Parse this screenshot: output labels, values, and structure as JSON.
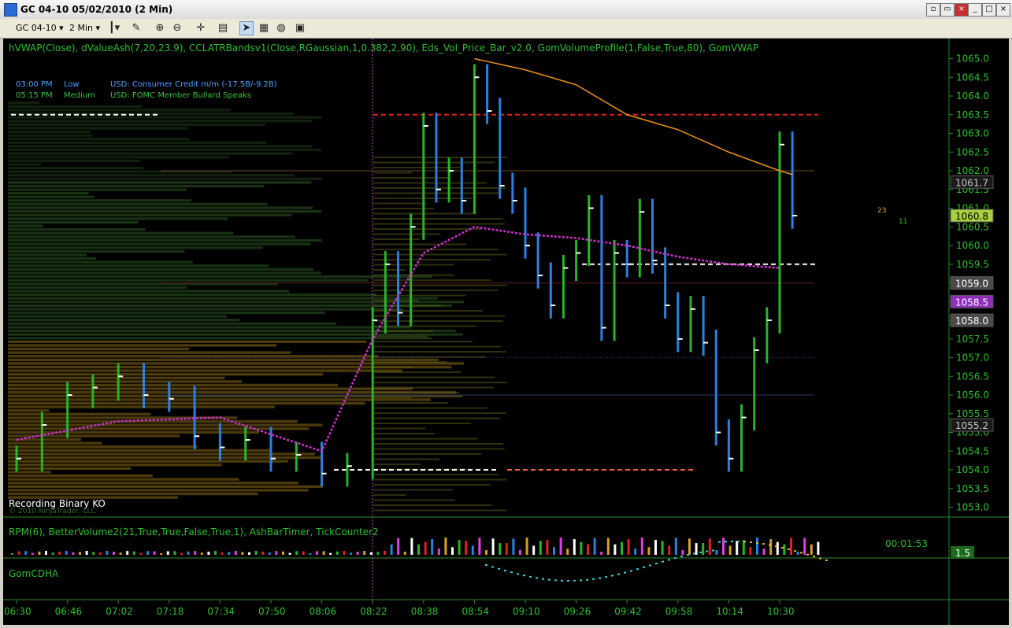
{
  "window": {
    "title": "GC 04-10  05/02/2010 (2 Min)",
    "buttons": [
      "minimize",
      "maximize",
      "close",
      "restore-sub",
      "maximize-sub",
      "close-sub"
    ]
  },
  "toolbar": {
    "instrument": "GC 04-10",
    "interval": "2 Min",
    "icons": [
      "bar-type-icon",
      "draw-icon",
      "zoom-in-icon",
      "zoom-out-icon",
      "crosshair-icon",
      "properties-icon",
      "strategy-icon",
      "chart-trader-icon",
      "indicator-icon",
      "data-box-icon"
    ]
  },
  "chart_data": {
    "type": "line",
    "indicator_header": "hVWAP(Close), dValueAsh(7,20,23.9), CCLATRBandsv1(Close,RGaussian,1,0.382,2,90), Eds_Vol_Price_Bar_v2.0, GomVolumeProfile(1,False,True,80), GomVWAP",
    "news": [
      {
        "time": "03:00 PM",
        "impact": "Low",
        "event": "USD: Consumer Credit m/m (-17.5B/-9.2B)"
      },
      {
        "time": "05:15 PM",
        "impact": "Medium",
        "event": "USD: FOMC Member Bullard Speaks"
      }
    ],
    "status_text": "Recording Binary KO",
    "copyright": "© 2010 NinjaTrader, LLC",
    "x_ticks": [
      "06:30",
      "06:46",
      "07:02",
      "07:18",
      "07:34",
      "07:50",
      "08:06",
      "08:22",
      "08:38",
      "08:54",
      "09:10",
      "09:26",
      "09:42",
      "09:58",
      "10:14",
      "10:30"
    ],
    "y_ticks": [
      "1065.0",
      "1064.5",
      "1064.0",
      "1063.5",
      "1063.0",
      "1062.5",
      "1062.0",
      "1061.5",
      "1061.0",
      "1060.5",
      "1060.0",
      "1059.5",
      "1059.0",
      "1058.5",
      "1058.0",
      "1057.5",
      "1057.0",
      "1056.5",
      "1056.0",
      "1055.5",
      "1055.0",
      "1054.5",
      "1054.0",
      "1053.5",
      "1053.0"
    ],
    "ylim": [
      1052.8,
      1065.2
    ],
    "price_labels": [
      {
        "value": 1061.7,
        "text": "1061.7",
        "color": "#1a1a1a",
        "fg": "#c8c8c8"
      },
      {
        "value": 1060.8,
        "text": "1060.8",
        "color": "#a8d040",
        "fg": "#000000"
      },
      {
        "value": 1059.0,
        "text": "1059.0",
        "color": "#4a4a4a",
        "fg": "#ffffff"
      },
      {
        "value": 1058.5,
        "text": "1058.5",
        "color": "#8e2fb8",
        "fg": "#ffffff"
      },
      {
        "value": 1058.0,
        "text": "1058.0",
        "color": "#4a4a4a",
        "fg": "#ffffff"
      },
      {
        "value": 1055.2,
        "text": "1055.2",
        "color": "#1a1a1a",
        "fg": "#c8c8c8"
      }
    ],
    "side_counts": [
      {
        "text": "23",
        "color": "#e8a020"
      },
      {
        "text": "11",
        "color": "#30c030"
      }
    ],
    "levels": [
      {
        "value": 1063.5,
        "color": "#e02020",
        "style": "dashed"
      },
      {
        "value": 1054.0,
        "color": "#ffffff",
        "style": "dashed"
      },
      {
        "value": 1059.5,
        "color": "#ffffff",
        "style": "dashed"
      }
    ],
    "series": [
      {
        "name": "Close",
        "color": "#30b030",
        "x": [
          "06:30",
          "06:38",
          "06:46",
          "06:54",
          "07:02",
          "07:10",
          "07:18",
          "07:26",
          "07:34",
          "07:42",
          "07:50",
          "07:58",
          "08:06",
          "08:14",
          "08:22",
          "08:26",
          "08:30",
          "08:34",
          "08:38",
          "08:42",
          "08:46",
          "08:50",
          "08:54",
          "08:58",
          "09:02",
          "09:06",
          "09:10",
          "09:14",
          "09:18",
          "09:22",
          "09:26",
          "09:30",
          "09:34",
          "09:38",
          "09:42",
          "09:46",
          "09:50",
          "09:54",
          "09:58",
          "10:02",
          "10:06",
          "10:10",
          "10:14",
          "10:18",
          "10:22",
          "10:26",
          "10:30",
          "10:34"
        ],
        "values": [
          1054.3,
          1055.2,
          1056.0,
          1056.2,
          1056.5,
          1056.0,
          1055.9,
          1054.9,
          1054.6,
          1054.8,
          1054.3,
          1054.4,
          1053.9,
          1054.1,
          1058.0,
          1059.5,
          1058.2,
          1060.5,
          1063.2,
          1061.5,
          1062.0,
          1061.2,
          1064.5,
          1063.6,
          1061.6,
          1061.2,
          1060.0,
          1059.2,
          1058.4,
          1059.4,
          1059.8,
          1061.0,
          1057.8,
          1059.8,
          1059.5,
          1060.9,
          1059.6,
          1058.4,
          1057.5,
          1058.3,
          1057.4,
          1055.0,
          1054.3,
          1055.4,
          1057.2,
          1058.0,
          1062.7,
          1060.8
        ]
      },
      {
        "name": "hVWAP",
        "color": "#cc33cc",
        "x": [
          "06:30",
          "07:02",
          "07:34",
          "08:06",
          "08:22",
          "08:38",
          "08:54",
          "09:10",
          "09:26",
          "09:42",
          "09:58",
          "10:14",
          "10:30"
        ],
        "values": [
          1054.8,
          1055.3,
          1055.4,
          1054.5,
          1057.5,
          1059.8,
          1060.5,
          1060.3,
          1060.2,
          1060.0,
          1059.7,
          1059.5,
          1059.4
        ]
      },
      {
        "name": "GomVWAP",
        "color": "#e89020",
        "x": [
          "08:54",
          "09:10",
          "09:26",
          "09:42",
          "09:58",
          "10:14",
          "10:30",
          "10:34"
        ],
        "values": [
          1065.0,
          1064.7,
          1064.3,
          1063.5,
          1063.1,
          1062.5,
          1062.0,
          1061.9
        ]
      }
    ],
    "panels": [
      {
        "header": "RPM(6), BetterVolume2(21,True,True,False,True,1), AshBarTimer, TickCounter2",
        "timer": "00:01:53",
        "value_label": "1.5"
      },
      {
        "header": "GomCDHA"
      }
    ]
  }
}
